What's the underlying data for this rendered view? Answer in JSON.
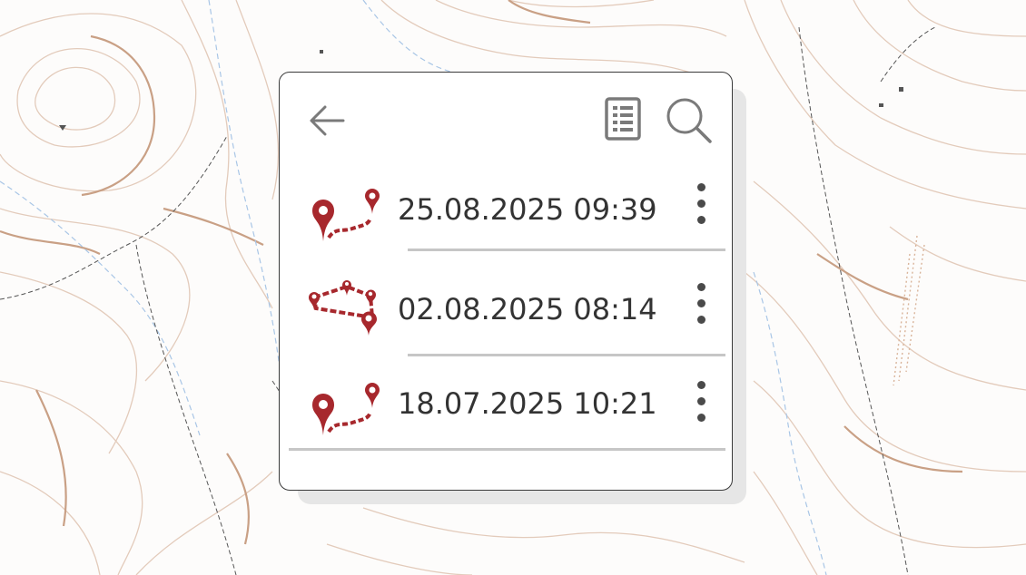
{
  "colors": {
    "accent": "#a7282d",
    "text": "#333333",
    "icon": "#7a7a7a",
    "divider": "#c6c6c6",
    "map_contour": "#d7b8a2",
    "map_water": "#a9c6e6",
    "map_path": "#555555"
  },
  "toolbar": {
    "back_icon": "arrow-left-icon",
    "list_icon": "list-document-icon",
    "search_icon": "magnifier-icon"
  },
  "tracks": [
    {
      "date": "25.08.2025 09:39",
      "icon": "route-two-pins-icon",
      "menu_icon": "kebab-menu-icon"
    },
    {
      "date": "02.08.2025 08:14",
      "icon": "route-loop-pins-icon",
      "menu_icon": "kebab-menu-icon"
    },
    {
      "date": "18.07.2025 10:21",
      "icon": "route-two-pins-icon",
      "menu_icon": "kebab-menu-icon"
    }
  ]
}
